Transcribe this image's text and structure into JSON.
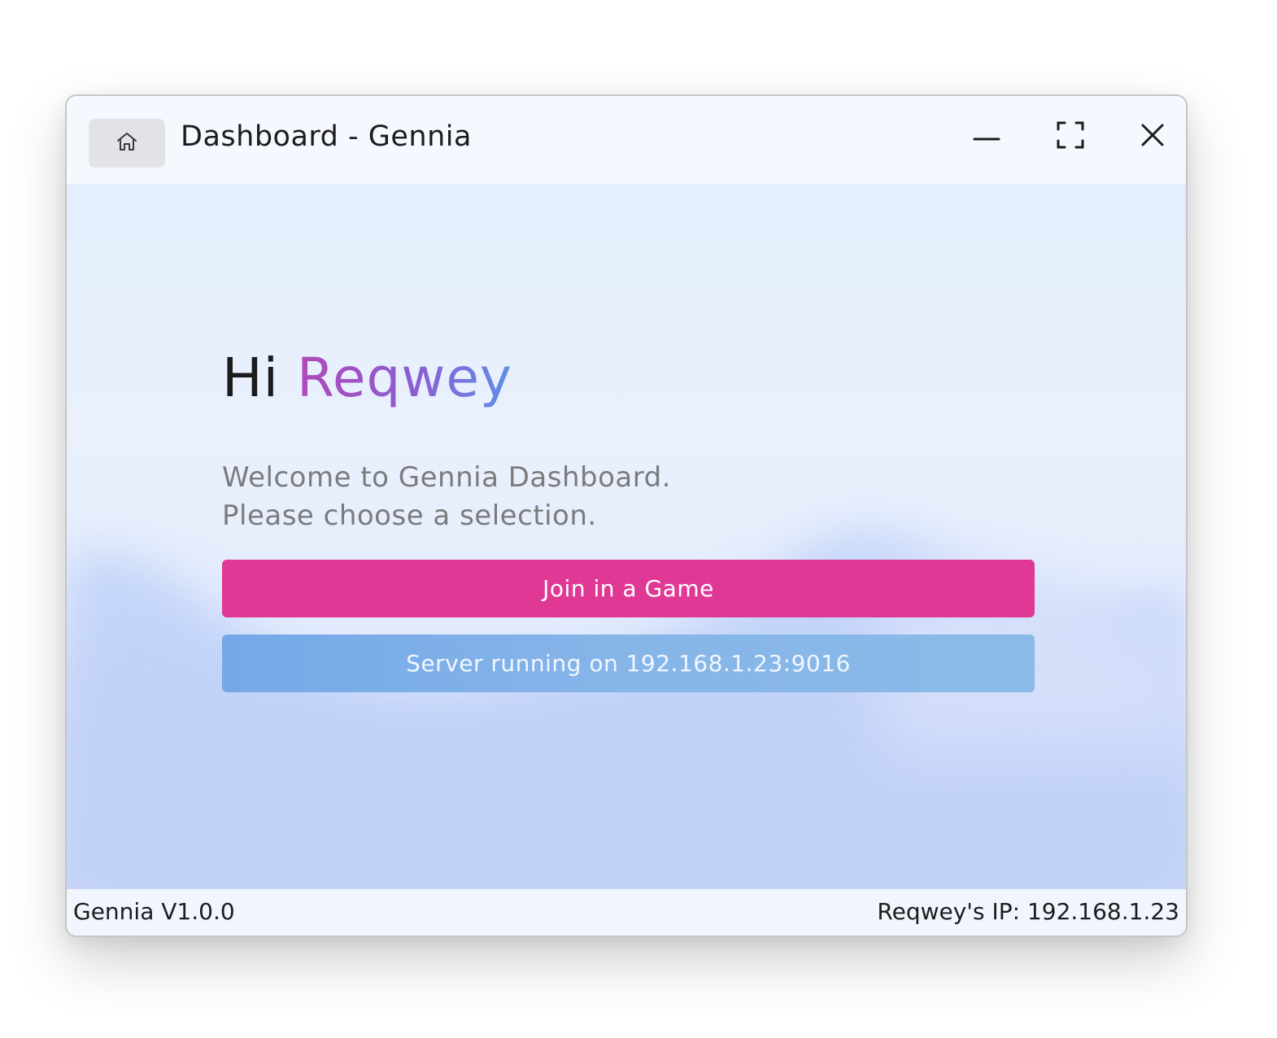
{
  "window": {
    "title": "Dashboard - Gennia"
  },
  "titlebar": {
    "home_icon": "home-icon",
    "minimize_icon": "minimize-icon",
    "maximize_icon": "maximize-icon",
    "close_icon": "close-icon"
  },
  "main": {
    "greeting_prefix": "Hi",
    "user_name": "Reqwey",
    "welcome_line1": "Welcome to Gennia Dashboard.",
    "welcome_line2": "Please choose a selection.",
    "join_button_label": "Join in a Game",
    "server_status_label": "Server running on 192.168.1.23:9016"
  },
  "statusbar": {
    "version": "Gennia V1.0.0",
    "ip_text": "Reqwey's IP: 192.168.1.23"
  },
  "colors": {
    "accent_pink": "#e03895",
    "server_blue": "#86b5e8",
    "name_gradient_start": "#b049b9",
    "name_gradient_end": "#5e8fe6"
  }
}
